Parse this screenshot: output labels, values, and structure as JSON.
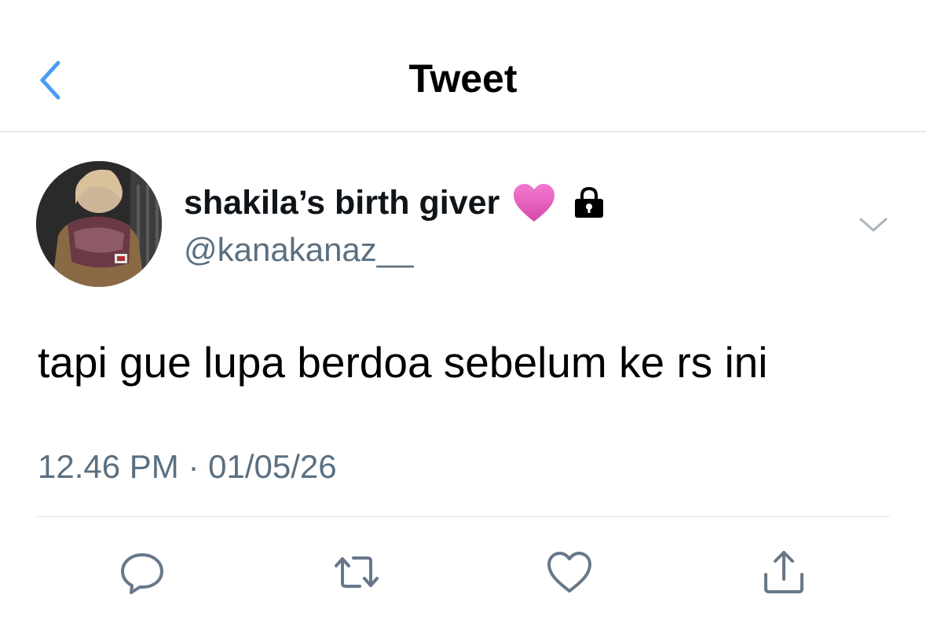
{
  "header": {
    "title": "Tweet",
    "back_icon": "chevron-left-icon",
    "accent_color": "#4a9cf0"
  },
  "author": {
    "display_name": "shakila’s birth giver",
    "handle": "@kanakanaz__",
    "badges": [
      "heart-icon",
      "lock-icon"
    ],
    "heart_color": "#e85bc0"
  },
  "tweet": {
    "text": "tapi gue lupa berdoa sebelum ke rs ini",
    "timestamp": "12.46 PM · 01/05/26"
  },
  "actions": [
    "reply-icon",
    "retweet-icon",
    "like-icon",
    "share-icon"
  ],
  "colors": {
    "secondary_text": "#5b6f80",
    "icon_gray": "#68788a",
    "divider": "#e1e4e7"
  }
}
